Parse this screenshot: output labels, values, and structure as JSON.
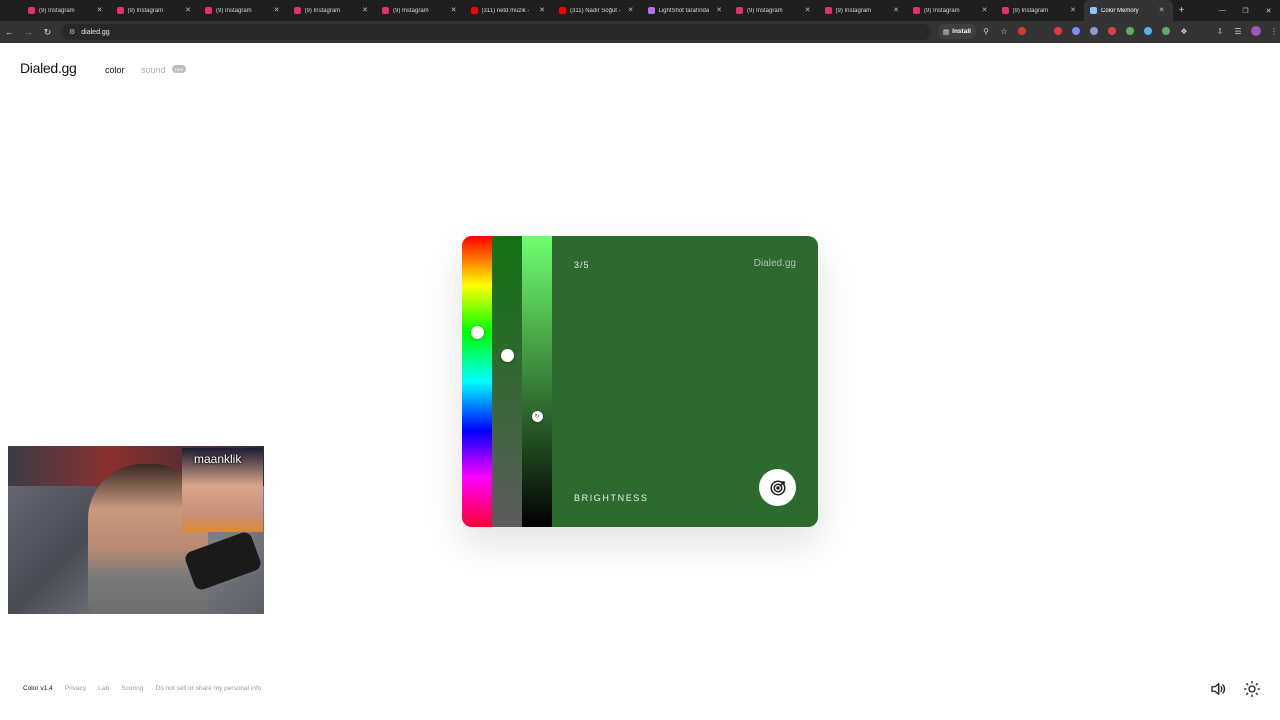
{
  "browser": {
    "tabs": [
      {
        "title": "(9) Instagram",
        "icon": "instagram-icon",
        "color": "#e1306c"
      },
      {
        "title": "(9) Instagram",
        "icon": "instagram-icon",
        "color": "#e1306c"
      },
      {
        "title": "(9) Instagram",
        "icon": "instagram-icon",
        "color": "#e1306c"
      },
      {
        "title": "(9) Instagram",
        "icon": "instagram-icon",
        "color": "#e1306c"
      },
      {
        "title": "(9) Instagram",
        "icon": "instagram-icon",
        "color": "#e1306c"
      },
      {
        "title": "(311) netd müzik -",
        "icon": "youtube-icon",
        "color": "#ff0000"
      },
      {
        "title": "(311) Nadir Söğüt -",
        "icon": "youtube-icon",
        "color": "#ff0000"
      },
      {
        "title": "LightShot tarafında",
        "icon": "lightshot-icon",
        "color": "#b96cf2"
      },
      {
        "title": "(9) Instagram",
        "icon": "instagram-icon",
        "color": "#e1306c"
      },
      {
        "title": "(9) Instagram",
        "icon": "instagram-icon",
        "color": "#e1306c"
      },
      {
        "title": "(9) Instagram",
        "icon": "instagram-icon",
        "color": "#e1306c"
      },
      {
        "title": "(9) Instagram",
        "icon": "instagram-icon",
        "color": "#e1306c"
      },
      {
        "title": "Color Memory",
        "icon": "dialed-icon",
        "color": "#8cc6ff",
        "active": true
      }
    ],
    "url": "dialed.gg",
    "install_label": "Install"
  },
  "site": {
    "logo": "Dialed.gg",
    "nav_color": "color",
    "nav_sound": "sound",
    "nav_sound_badge": "new"
  },
  "game": {
    "round": "3/5",
    "brand": "Dialed.gg",
    "mode": "BRIGHTNESS",
    "swatch_color": "#2d6a2d",
    "hue_position": 0.33,
    "saturation_position": 0.41,
    "brightness_position": 0.62
  },
  "webcam": {
    "pip_name": "maanklik"
  },
  "footer": {
    "version": "Color v1.4",
    "links": [
      "Privacy",
      "Lab",
      "Scoring",
      "Do not sell or share my personal info"
    ]
  }
}
